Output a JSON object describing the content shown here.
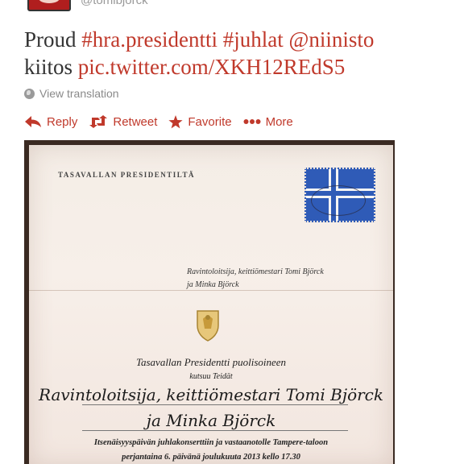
{
  "tweet": {
    "handle": "@tomibjorck",
    "text_plain_1": "Proud ",
    "hashtag_1": "#hra.presidentti",
    "text_plain_2": " ",
    "hashtag_2": "#juhlat",
    "text_plain_3": " ",
    "mention": "@niinisto",
    "text_plain_4": "kiitos ",
    "link": "pic.twitter.com/XKH12REdS5"
  },
  "translate_label": "View translation",
  "actions": {
    "reply": "Reply",
    "retweet": "Retweet",
    "favorite": "Favorite",
    "more": "More"
  },
  "colors": {
    "link": "#c0392b",
    "text": "#333333",
    "muted": "#8a8a8a"
  },
  "icons": [
    "globe-icon",
    "reply-icon",
    "retweet-icon",
    "star-icon",
    "more-dots-icon"
  ],
  "photo": {
    "letterhead": "TASAVALLAN PRESIDENTILTÄ",
    "address_line_1": "Ravintoloitsija, keittiömestari Tomi Björck",
    "address_line_2": "ja Minka Björck",
    "invitation_line_1": "Tasavallan Presidentti puolisoineen",
    "invitation_line_2": "kutsuu Teidät",
    "handwritten_1": "Ravintoloitsija, keittiömestari Tomi Björck",
    "handwritten_2": "ja Minka Björck",
    "invitation_line_3": "Itsenäisyyspäivän juhlakonserttiin ja vastaanotolle Tampere-taloon",
    "invitation_line_4": "perjantaina 6. päivänä joulukuuta 2013 kello 17.30"
  }
}
